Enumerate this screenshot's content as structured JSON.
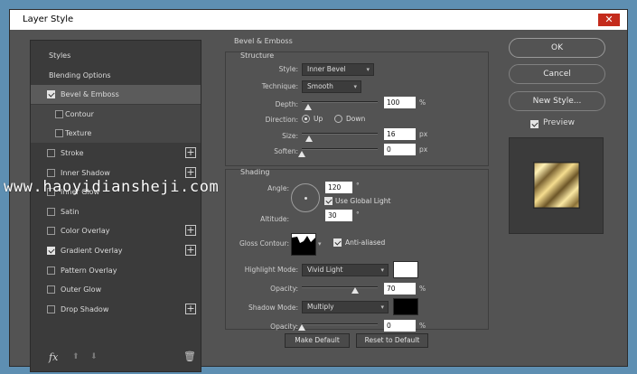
{
  "window": {
    "title": "Layer Style",
    "close_glyph": "✕"
  },
  "left_list": {
    "items": [
      {
        "label": "Styles",
        "checkbox": false,
        "checked": false,
        "plus": false,
        "selected": false,
        "sub": false
      },
      {
        "label": "Blending Options",
        "checkbox": false,
        "checked": false,
        "plus": false,
        "selected": false,
        "sub": false
      },
      {
        "label": "Bevel & Emboss",
        "checkbox": true,
        "checked": true,
        "plus": false,
        "selected": true,
        "sub": false
      },
      {
        "label": "Contour",
        "checkbox": true,
        "checked": false,
        "plus": false,
        "selected": false,
        "sub": true
      },
      {
        "label": "Texture",
        "checkbox": true,
        "checked": false,
        "plus": false,
        "selected": false,
        "sub": true
      },
      {
        "label": "Stroke",
        "checkbox": true,
        "checked": false,
        "plus": true,
        "selected": false,
        "sub": false
      },
      {
        "label": "Inner Shadow",
        "checkbox": true,
        "checked": false,
        "plus": true,
        "selected": false,
        "sub": false
      },
      {
        "label": "Inner Glow",
        "checkbox": true,
        "checked": false,
        "plus": false,
        "selected": false,
        "sub": false
      },
      {
        "label": "Satin",
        "checkbox": true,
        "checked": false,
        "plus": false,
        "selected": false,
        "sub": false
      },
      {
        "label": "Color Overlay",
        "checkbox": true,
        "checked": false,
        "plus": true,
        "selected": false,
        "sub": false
      },
      {
        "label": "Gradient Overlay",
        "checkbox": true,
        "checked": true,
        "plus": true,
        "selected": false,
        "sub": false
      },
      {
        "label": "Pattern Overlay",
        "checkbox": true,
        "checked": false,
        "plus": false,
        "selected": false,
        "sub": false
      },
      {
        "label": "Outer Glow",
        "checkbox": true,
        "checked": false,
        "plus": false,
        "selected": false,
        "sub": false
      },
      {
        "label": "Drop Shadow",
        "checkbox": true,
        "checked": false,
        "plus": true,
        "selected": false,
        "sub": false
      }
    ],
    "plus_glyph": "+",
    "footer": {
      "fx_label": "fx",
      "fx_icon": "fx-icon",
      "up_icon": "move-up-icon",
      "down_icon": "move-down-icon",
      "trash_icon": "trash-icon",
      "up_glyph": "⬆",
      "down_glyph": "⬇",
      "trash_glyph": "🗑"
    }
  },
  "bevel": {
    "title": "Bevel & Emboss",
    "structure_title": "Structure",
    "style_label": "Style:",
    "style_value": "Inner Bevel",
    "technique_label": "Technique:",
    "technique_value": "Smooth",
    "depth_label": "Depth:",
    "depth_value": "100",
    "depth_unit": "%",
    "depth_slider": 0.08,
    "direction_label": "Direction:",
    "direction_up": "Up",
    "direction_down": "Down",
    "direction_selected": "Up",
    "size_label": "Size:",
    "size_value": "16",
    "size_unit": "px",
    "size_slider": 0.1,
    "soften_label": "Soften:",
    "soften_value": "0",
    "soften_unit": "px",
    "soften_slider": 0.0
  },
  "shading": {
    "title": "Shading",
    "angle_label": "Angle:",
    "angle_value": "120",
    "angle_unit": "°",
    "use_global_light_label": "Use Global Light",
    "use_global_light_checked": true,
    "altitude_label": "Altitude:",
    "altitude_value": "30",
    "altitude_unit": "°",
    "gloss_contour_label": "Gloss Contour:",
    "anti_aliased_label": "Anti-aliased",
    "anti_aliased_checked": true,
    "highlight_mode_label": "Highlight Mode:",
    "highlight_mode_value": "Vivid Light",
    "highlight_color": "#ffffff",
    "highlight_opacity_label": "Opacity:",
    "highlight_opacity_value": "70",
    "highlight_opacity_unit": "%",
    "highlight_opacity_slider": 0.7,
    "shadow_mode_label": "Shadow Mode:",
    "shadow_mode_value": "Multiply",
    "shadow_color": "#000000",
    "shadow_opacity_label": "Opacity:",
    "shadow_opacity_value": "0",
    "shadow_opacity_unit": "%",
    "shadow_opacity_slider": 0.0,
    "make_default_label": "Make Default",
    "reset_default_label": "Reset to Default"
  },
  "right": {
    "ok_label": "OK",
    "cancel_label": "Cancel",
    "new_style_label": "New Style...",
    "preview_label": "Preview",
    "preview_checked": true
  },
  "watermark": "www.haoyidiansheji.com",
  "colors": {
    "panel_bg": "#535353",
    "list_bg": "#3b3b3b",
    "selected_bg": "#5b5b5b",
    "close_red": "#c42b1c"
  }
}
